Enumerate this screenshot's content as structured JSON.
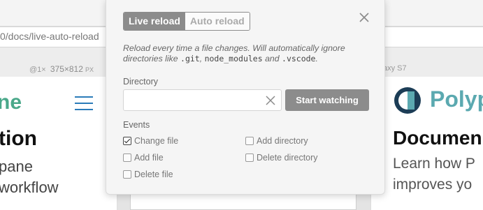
{
  "browser": {
    "url": "0/docs/live-auto-reload",
    "left_device": {
      "zoom": "@1×",
      "dimensions": "375×812",
      "unit": "PX"
    },
    "right_device_label": "axy S7"
  },
  "left_preview": {
    "logo_fragment": "ne",
    "heading_fragment": "tion",
    "subtitle_lines": [
      "pane",
      "workflow"
    ]
  },
  "right_preview": {
    "logo_fragment": "Polyp",
    "heading_fragment": "Documen",
    "subtitle_lines": [
      "Learn how P",
      "improves yo"
    ]
  },
  "panel": {
    "toggle": {
      "live_label": "Live reload",
      "auto_label": "Auto reload",
      "selected": "live"
    },
    "description": {
      "text_before": "Reload every time a file changes. Will automatically ignore directories like ",
      "code1": ".git",
      "sep": ", ",
      "code2": "node_modules",
      "and": " and ",
      "code3": ".vscode",
      "end": "."
    },
    "directory_label": "Directory",
    "directory_value": "",
    "directory_placeholder": "",
    "start_button": "Start watching",
    "events_label": "Events",
    "events": [
      {
        "label": "Change file",
        "checked": true
      },
      {
        "label": "Add directory",
        "checked": false
      },
      {
        "label": "Add file",
        "checked": false
      },
      {
        "label": "Delete directory",
        "checked": false
      },
      {
        "label": "Delete file",
        "checked": false
      }
    ]
  },
  "colors": {
    "accent_gray": "#8c8c8c",
    "left_logo_green": "#4aa88a",
    "right_logo_teal": "#5ba9b0",
    "menu_blue": "#2b7bb9"
  },
  "icons": [
    "close-icon",
    "clear-input-icon",
    "hamburger-menu-icon",
    "polypane-logo-icon",
    "checkbox-check-icon"
  ]
}
